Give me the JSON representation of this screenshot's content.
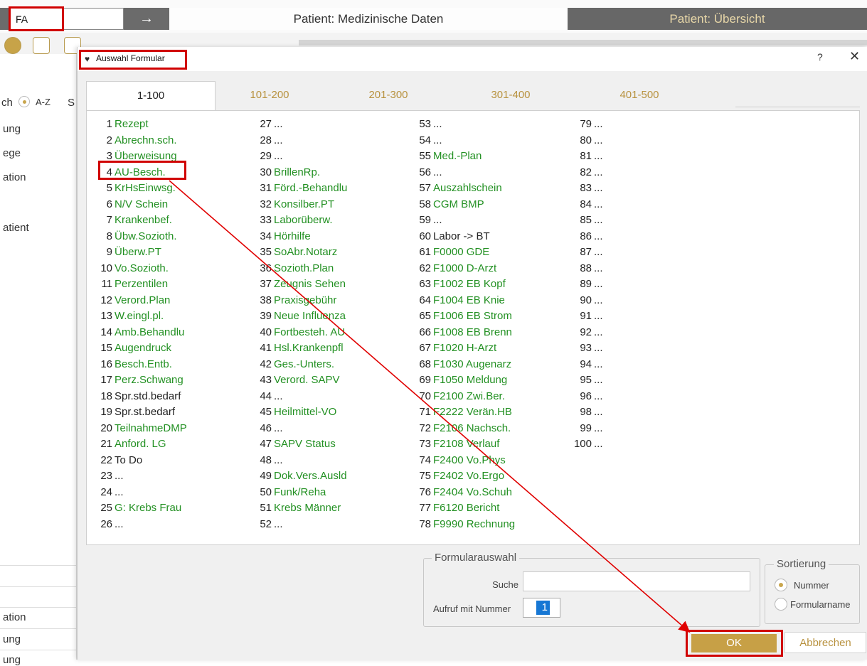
{
  "topbar": {
    "command_value": "FA",
    "arrow": "→",
    "title_center": "Patient: Medizinische Daten",
    "title_right": "Patient: Übersicht"
  },
  "leftpanel": {
    "sort_label_a": "ch",
    "sort_label_az": "A-Z",
    "sort_label_s": "S",
    "items": [
      "ung",
      "ege",
      "ation",
      "atient"
    ],
    "bottom_items": [
      "ation",
      "ung",
      "ung"
    ]
  },
  "dialog": {
    "title": "Auswahl Formular",
    "help": "?",
    "close": "✕",
    "tabs": [
      "1-100",
      "101-200",
      "201-300",
      "301-400",
      "401-500"
    ],
    "active_tab": 0,
    "columns": [
      [
        {
          "n": "1",
          "t": "Rezept",
          "g": true
        },
        {
          "n": "2",
          "t": "Abrechn.sch.",
          "g": true
        },
        {
          "n": "3",
          "t": "Überweisung",
          "g": true
        },
        {
          "n": "4",
          "t": "AU-Besch.",
          "g": true
        },
        {
          "n": "5",
          "t": "KrHsEinwsg.",
          "g": true
        },
        {
          "n": "6",
          "t": "N/V Schein",
          "g": true
        },
        {
          "n": "7",
          "t": "Krankenbef.",
          "g": true
        },
        {
          "n": "8",
          "t": "Übw.Sozioth.",
          "g": true
        },
        {
          "n": "9",
          "t": "Überw.PT",
          "g": true
        },
        {
          "n": "10",
          "t": "Vo.Sozioth.",
          "g": true
        },
        {
          "n": "11",
          "t": "Perzentilen",
          "g": true
        },
        {
          "n": "12",
          "t": "Verord.Plan",
          "g": true
        },
        {
          "n": "13",
          "t": "W.eingl.pl.",
          "g": true
        },
        {
          "n": "14",
          "t": "Amb.Behandlu",
          "g": true
        },
        {
          "n": "15",
          "t": "Augendruck",
          "g": true
        },
        {
          "n": "16",
          "t": "Besch.Entb.",
          "g": true
        },
        {
          "n": "17",
          "t": "Perz.Schwang",
          "g": true
        },
        {
          "n": "18",
          "t": "Spr.std.bedarf",
          "g": false
        },
        {
          "n": "19",
          "t": "Spr.st.bedarf",
          "g": false
        },
        {
          "n": "20",
          "t": "TeilnahmeDMP",
          "g": true
        },
        {
          "n": "21",
          "t": "Anford. LG",
          "g": true
        },
        {
          "n": "22",
          "t": "To Do",
          "g": false
        },
        {
          "n": "23",
          "t": "...",
          "g": false
        },
        {
          "n": "24",
          "t": "...",
          "g": false
        },
        {
          "n": "25",
          "t": "G: Krebs Frau",
          "g": true
        },
        {
          "n": "26",
          "t": "...",
          "g": false
        }
      ],
      [
        {
          "n": "27",
          "t": "...",
          "g": false
        },
        {
          "n": "28",
          "t": "...",
          "g": false
        },
        {
          "n": "29",
          "t": "...",
          "g": false
        },
        {
          "n": "30",
          "t": "BrillenRp.",
          "g": true
        },
        {
          "n": "31",
          "t": "Förd.-Behandlu",
          "g": true
        },
        {
          "n": "32",
          "t": "Konsilber.PT",
          "g": true
        },
        {
          "n": "33",
          "t": "Laborüberw.",
          "g": true
        },
        {
          "n": "34",
          "t": "Hörhilfe",
          "g": true
        },
        {
          "n": "35",
          "t": "SoAbr.Notarz",
          "g": true
        },
        {
          "n": "36",
          "t": "Sozioth.Plan",
          "g": true
        },
        {
          "n": "37",
          "t": "Zeugnis Sehen",
          "g": true
        },
        {
          "n": "38",
          "t": "Praxisgebühr",
          "g": true
        },
        {
          "n": "39",
          "t": "Neue Influenza",
          "g": true
        },
        {
          "n": "40",
          "t": "Fortbesteh. AU",
          "g": true
        },
        {
          "n": "41",
          "t": "Hsl.Krankenpfl",
          "g": true
        },
        {
          "n": "42",
          "t": "Ges.-Unters.",
          "g": true
        },
        {
          "n": "43",
          "t": "Verord. SAPV",
          "g": true
        },
        {
          "n": "44",
          "t": "...",
          "g": false
        },
        {
          "n": "45",
          "t": "Heilmittel-VO",
          "g": true
        },
        {
          "n": "46",
          "t": "...",
          "g": false
        },
        {
          "n": "47",
          "t": "SAPV Status",
          "g": true
        },
        {
          "n": "48",
          "t": "...",
          "g": false
        },
        {
          "n": "49",
          "t": "Dok.Vers.Ausld",
          "g": true
        },
        {
          "n": "50",
          "t": "Funk/Reha",
          "g": true
        },
        {
          "n": "51",
          "t": "Krebs  Männer",
          "g": true
        },
        {
          "n": "52",
          "t": "...",
          "g": false
        }
      ],
      [
        {
          "n": "53",
          "t": "...",
          "g": false
        },
        {
          "n": "54",
          "t": "...",
          "g": false
        },
        {
          "n": "55",
          "t": "Med.-Plan",
          "g": true
        },
        {
          "n": "56",
          "t": "...",
          "g": false
        },
        {
          "n": "57",
          "t": "Auszahlschein",
          "g": true
        },
        {
          "n": "58",
          "t": "CGM BMP",
          "g": true
        },
        {
          "n": "59",
          "t": "...",
          "g": false
        },
        {
          "n": "60",
          "t": "Labor -> BT",
          "g": false
        },
        {
          "n": "61",
          "t": "F0000 GDE",
          "g": true
        },
        {
          "n": "62",
          "t": "F1000 D-Arzt",
          "g": true
        },
        {
          "n": "63",
          "t": "F1002 EB Kopf",
          "g": true
        },
        {
          "n": "64",
          "t": "F1004 EB Knie",
          "g": true
        },
        {
          "n": "65",
          "t": "F1006 EB Strom",
          "g": true
        },
        {
          "n": "66",
          "t": "F1008 EB Brenn",
          "g": true
        },
        {
          "n": "67",
          "t": "F1020 H-Arzt",
          "g": true
        },
        {
          "n": "68",
          "t": "F1030 Augenarz",
          "g": true
        },
        {
          "n": "69",
          "t": "F1050 Meldung",
          "g": true
        },
        {
          "n": "70",
          "t": "F2100 Zwi.Ber.",
          "g": true
        },
        {
          "n": "71",
          "t": "F2222 Verän.HB",
          "g": true
        },
        {
          "n": "72",
          "t": "F2106 Nachsch.",
          "g": true
        },
        {
          "n": "73",
          "t": "F2108 Verlauf",
          "g": true
        },
        {
          "n": "74",
          "t": "F2400 Vo.Phys",
          "g": true
        },
        {
          "n": "75",
          "t": "F2402 Vo.Ergo",
          "g": true
        },
        {
          "n": "76",
          "t": "F2404 Vo.Schuh",
          "g": true
        },
        {
          "n": "77",
          "t": "F6120 Bericht",
          "g": true
        },
        {
          "n": "78",
          "t": "F9990 Rechnung",
          "g": true
        }
      ],
      [
        {
          "n": "79",
          "t": "...",
          "g": false
        },
        {
          "n": "80",
          "t": "...",
          "g": false
        },
        {
          "n": "81",
          "t": "...",
          "g": false
        },
        {
          "n": "82",
          "t": "...",
          "g": false
        },
        {
          "n": "83",
          "t": "...",
          "g": false
        },
        {
          "n": "84",
          "t": "...",
          "g": false
        },
        {
          "n": "85",
          "t": "...",
          "g": false
        },
        {
          "n": "86",
          "t": "...",
          "g": false
        },
        {
          "n": "87",
          "t": "...",
          "g": false
        },
        {
          "n": "88",
          "t": "...",
          "g": false
        },
        {
          "n": "89",
          "t": "...",
          "g": false
        },
        {
          "n": "90",
          "t": "...",
          "g": false
        },
        {
          "n": "91",
          "t": "...",
          "g": false
        },
        {
          "n": "92",
          "t": "...",
          "g": false
        },
        {
          "n": "93",
          "t": "...",
          "g": false
        },
        {
          "n": "94",
          "t": "...",
          "g": false
        },
        {
          "n": "95",
          "t": "...",
          "g": false
        },
        {
          "n": "96",
          "t": "...",
          "g": false
        },
        {
          "n": "98",
          "t": "...",
          "g": false
        },
        {
          "n": "99",
          "t": "...",
          "g": false
        },
        {
          "n": "100",
          "t": "...",
          "g": false
        }
      ]
    ],
    "formularauswahl": {
      "title": "Formularauswahl",
      "suche_label": "Suche",
      "suche_value": "",
      "aufruf_label": "Aufruf mit Nummer",
      "aufruf_value": "1"
    },
    "sortierung": {
      "title": "Sortierung",
      "options": [
        "Nummer",
        "Formularname"
      ],
      "selected": "Nummer"
    },
    "buttons": {
      "ok": "OK",
      "cancel": "Abbrechen"
    }
  },
  "colors": {
    "accent_gold": "#c7a046",
    "highlight_red": "#d00000",
    "item_green": "#229022"
  }
}
